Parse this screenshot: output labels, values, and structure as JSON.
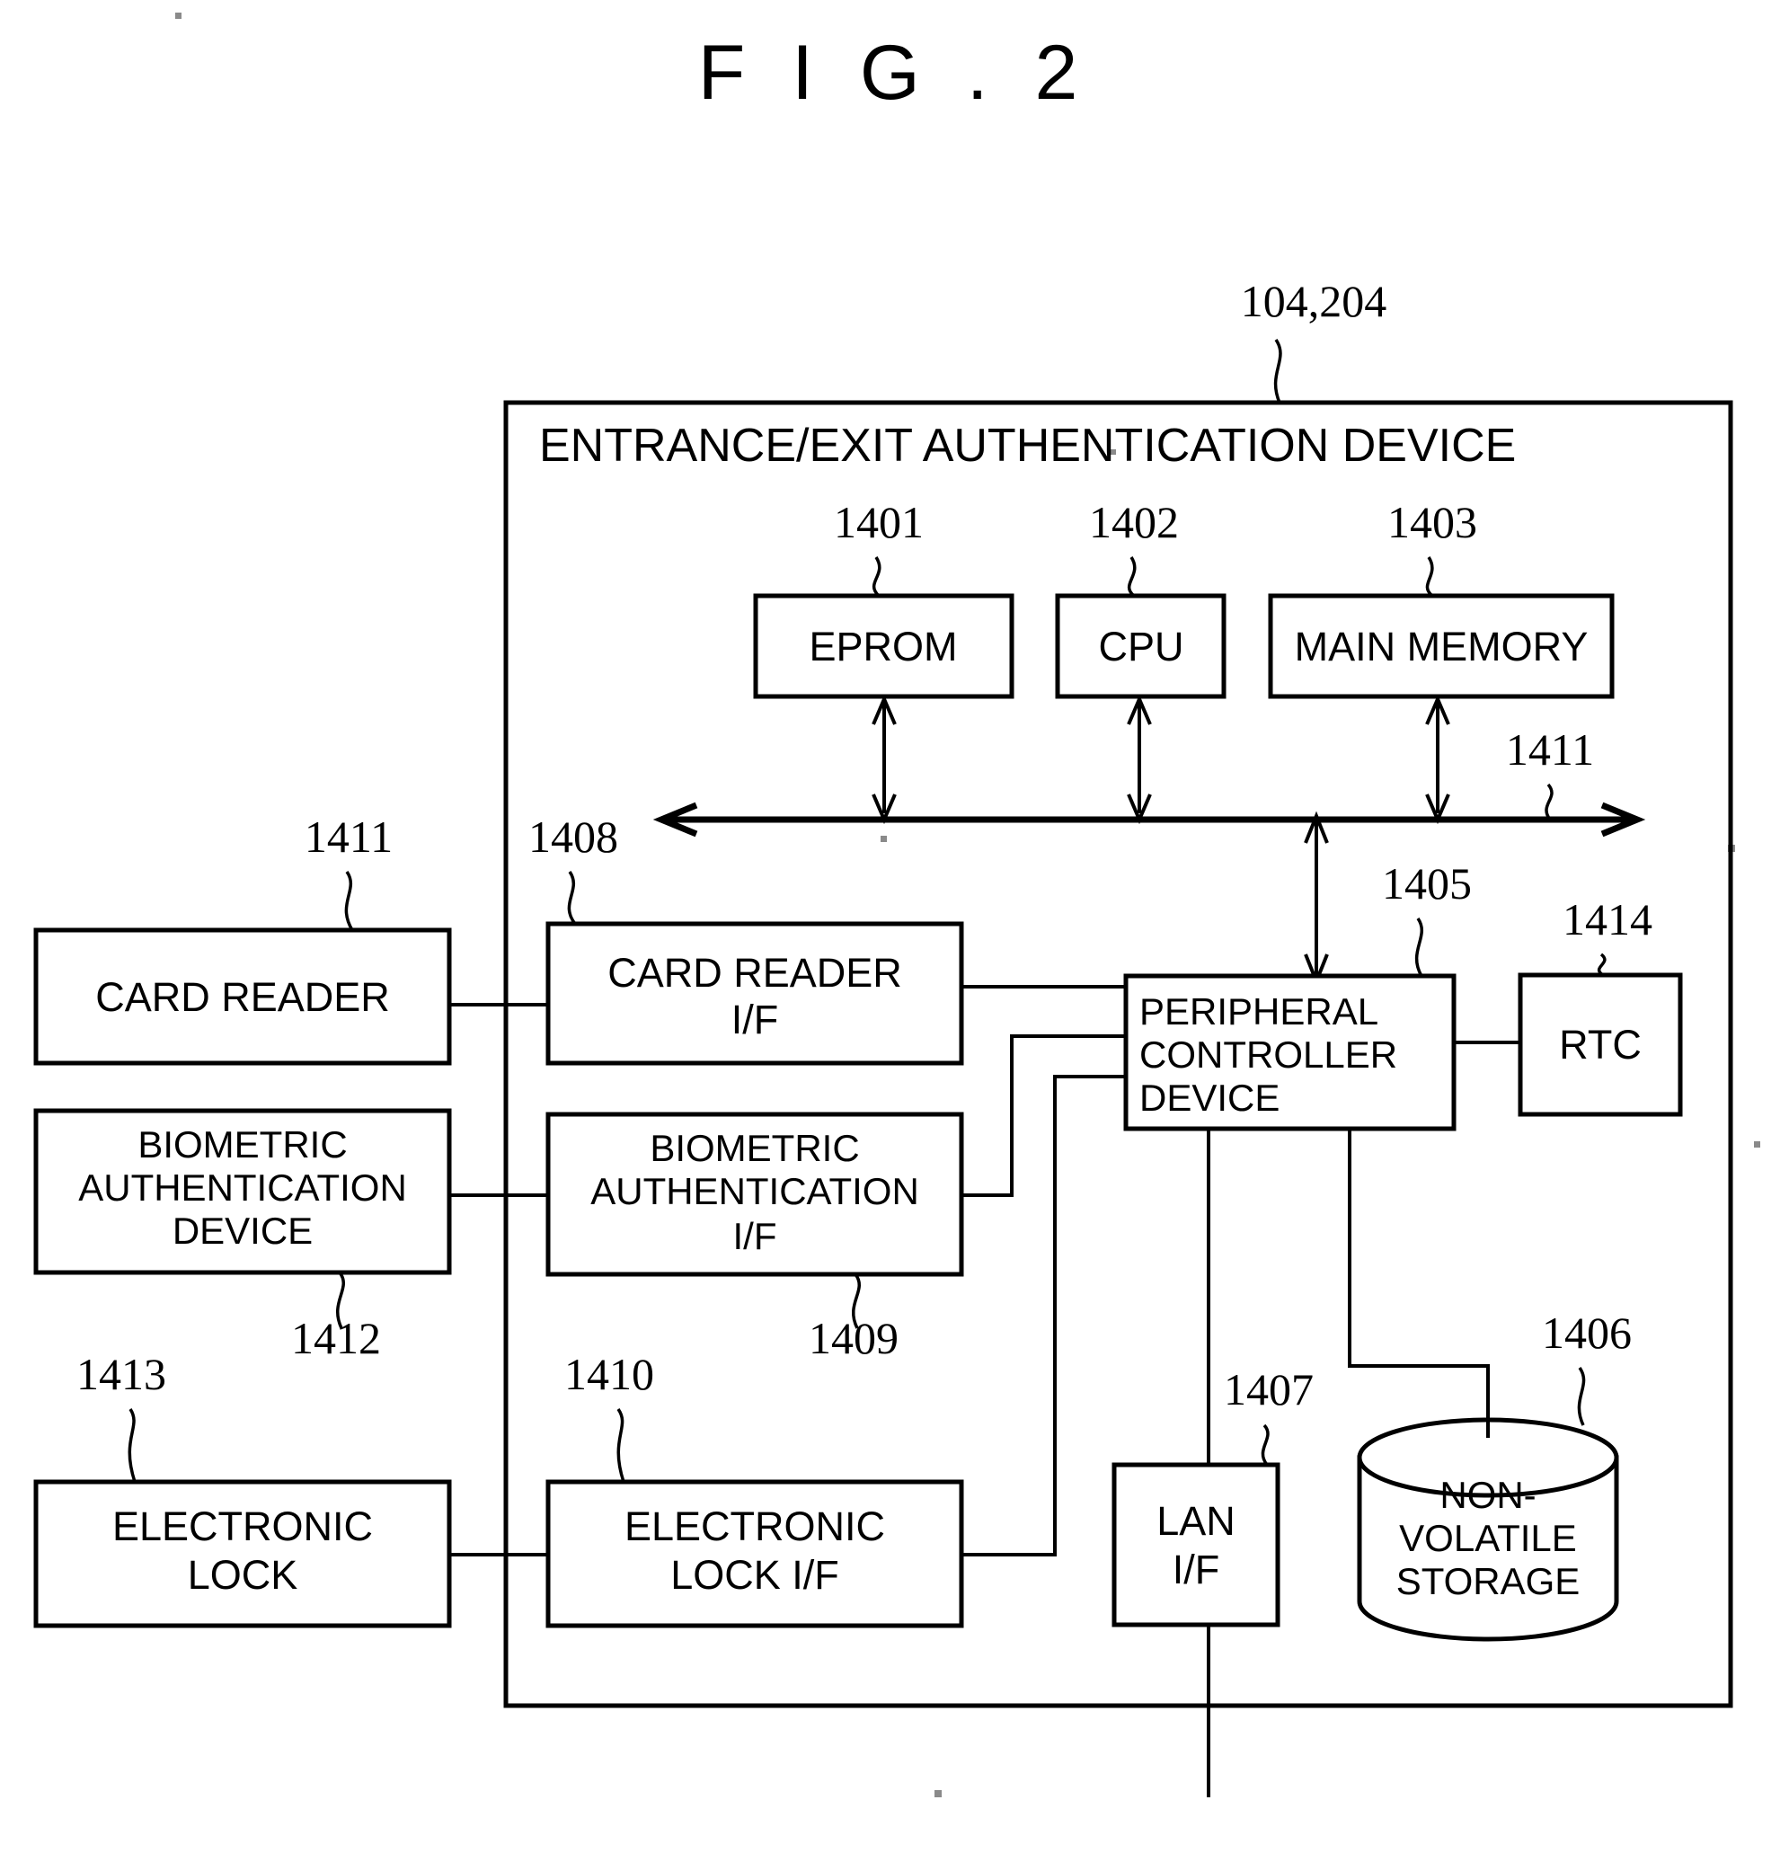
{
  "figure": {
    "title": "F I G . 2",
    "device_title": "ENTRANCE/EXIT AUTHENTICATION DEVICE",
    "device_ref": "104,204"
  },
  "blocks": {
    "eprom": {
      "label": "EPROM",
      "ref": "1401"
    },
    "cpu": {
      "label": "CPU",
      "ref": "1402"
    },
    "main_memory": {
      "label": "MAIN MEMORY",
      "ref": "1403"
    },
    "bus": {
      "ref_right": "1411"
    },
    "card_reader": {
      "label": "CARD READER",
      "ref": "1411"
    },
    "card_reader_if": {
      "label_line1": "CARD READER",
      "label_line2": "I/F",
      "ref": "1408"
    },
    "biometric_device": {
      "label_line1": "BIOMETRIC",
      "label_line2": "AUTHENTICATION",
      "label_line3": "DEVICE",
      "ref": "1412"
    },
    "biometric_if": {
      "label_line1": "BIOMETRIC",
      "label_line2": "AUTHENTICATION",
      "label_line3": "I/F",
      "ref": "1409"
    },
    "electronic_lock": {
      "label_line1": "ELECTRONIC",
      "label_line2": "LOCK",
      "ref": "1413"
    },
    "electronic_lock_if": {
      "label_line1": "ELECTRONIC",
      "label_line2": "LOCK I/F",
      "ref": "1410"
    },
    "peripheral_controller": {
      "label_line1": "PERIPHERAL",
      "label_line2": "CONTROLLER",
      "label_line3": "DEVICE",
      "ref": "1405"
    },
    "rtc": {
      "label": "RTC",
      "ref": "1414"
    },
    "lan_if": {
      "label_line1": "LAN",
      "label_line2": "I/F",
      "ref": "1407"
    },
    "nonvolatile_storage": {
      "label_line1": "NON-",
      "label_line2": "VOLATILE",
      "label_line3": "STORAGE",
      "ref": "1406"
    }
  },
  "colors": {
    "ink": "#000000",
    "paper": "#ffffff"
  }
}
